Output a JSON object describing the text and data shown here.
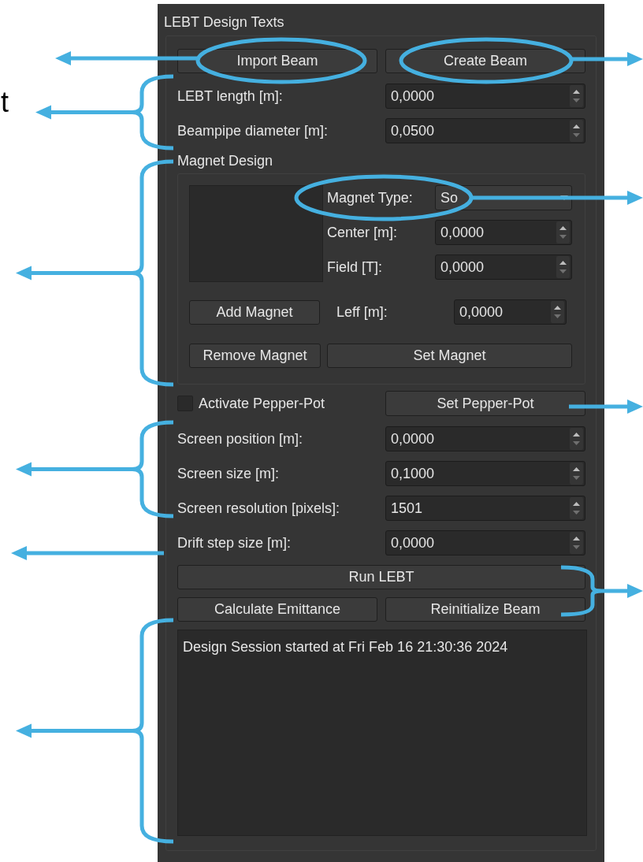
{
  "annotation_text": "t",
  "panel": {
    "title": "LEBT Design Texts",
    "top_buttons": [
      "Import Beam",
      "Create Beam"
    ],
    "beam_fields": [
      {
        "label": "LEBT length [m]:",
        "value": "0,0000"
      },
      {
        "label": "Beampipe diameter [m]:",
        "value": "0,0500"
      }
    ],
    "magnet_design": {
      "title": "Magnet Design",
      "type_label": "Magnet Type:",
      "type_value": "So",
      "fields": [
        {
          "label": "Center [m]:",
          "value": "0,0000"
        },
        {
          "label": "Field [T]:",
          "value": "0,0000"
        }
      ],
      "add_button": "Add Magnet",
      "leff": {
        "label": "Leff [m]:",
        "value": "0,0000"
      },
      "remove_button": "Remove Magnet",
      "set_button": "Set Magnet"
    },
    "pepper_pot": {
      "checkbox_label": "Activate Pepper-Pot",
      "checked": false,
      "button": "Set Pepper-Pot"
    },
    "screen_fields": [
      {
        "label": "Screen position [m]:",
        "value": "0,0000"
      },
      {
        "label": "Screen size [m]:",
        "value": "0,1000"
      },
      {
        "label": "Screen resolution [pixels]:",
        "value": "1501"
      },
      {
        "label": "Drift step size [m]:",
        "value": "0,0000"
      }
    ],
    "run_button": "Run LEBT",
    "bottom_buttons": [
      "Calculate Emittance",
      "Reinitialize Beam"
    ],
    "log": [
      "Design Session started at Fri Feb 16 21:30:36 2024"
    ]
  }
}
